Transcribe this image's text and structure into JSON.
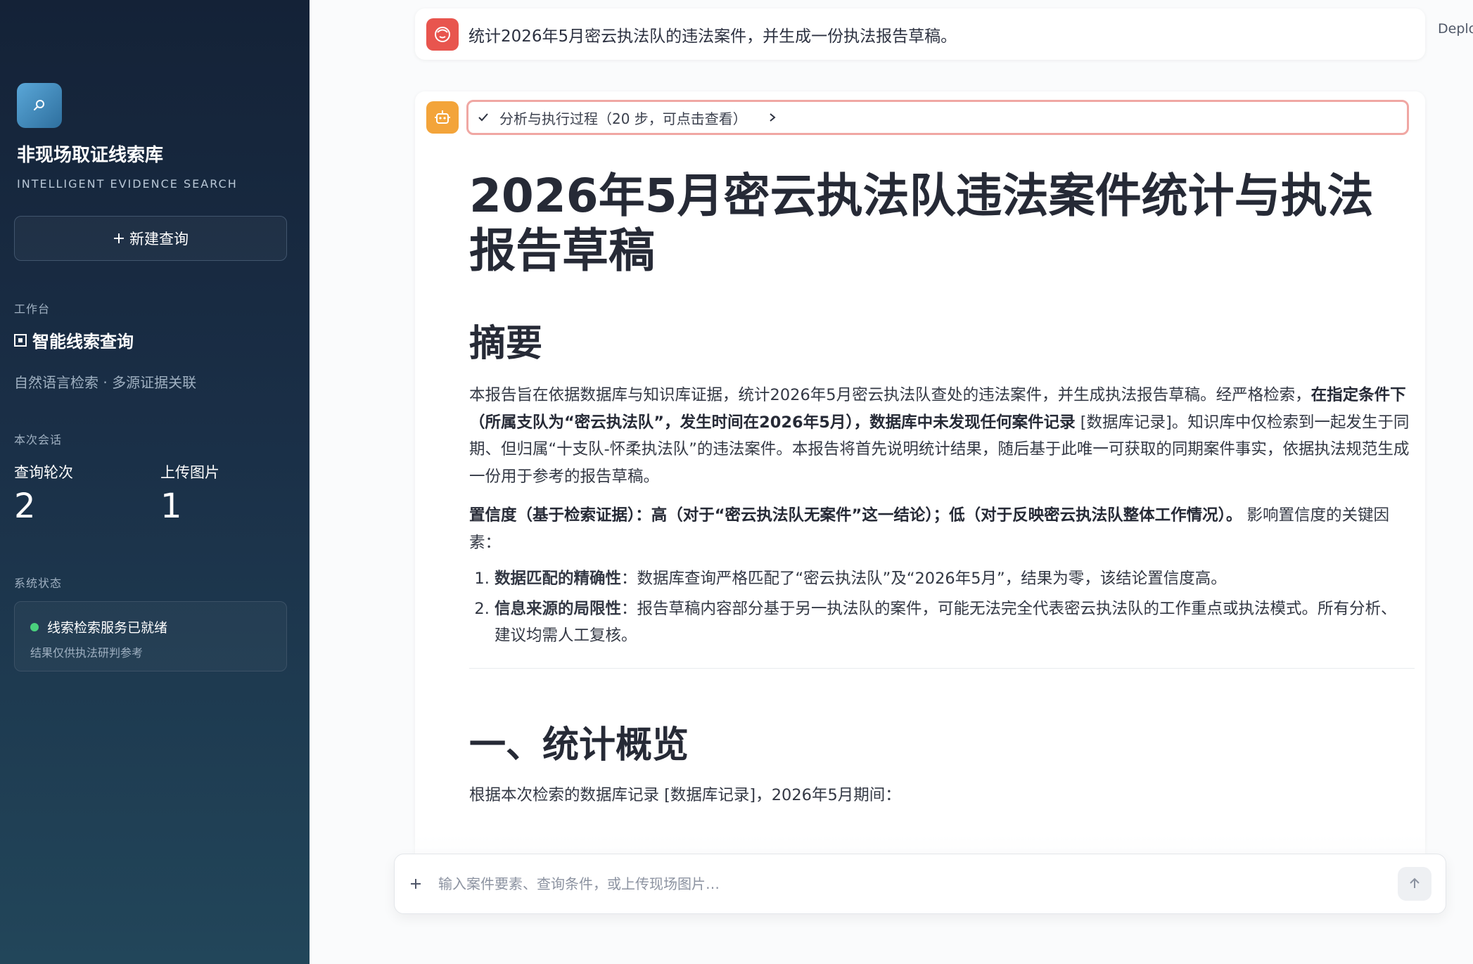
{
  "app": {
    "title": "非现场取证线索库",
    "subtitle": "INTELLIGENT EVIDENCE SEARCH",
    "new_query_label": "新建查询"
  },
  "sidebar": {
    "workbench_label": "工作台",
    "workbench_item": "智能线索查询",
    "workbench_desc": "自然语言检索 · 多源证据关联",
    "session_label": "本次会话",
    "stats": [
      {
        "label": "查询轮次",
        "value": "2"
      },
      {
        "label": "上传图片",
        "value": "1"
      }
    ],
    "system_label": "系统状态",
    "status_text": "线索检索服务已就绪",
    "status_note": "结果仅供执法研判参考",
    "status_color": "#4ad17d"
  },
  "header": {
    "deploy_label": "Deplo"
  },
  "chat": {
    "user_message": "统计2026年5月密云执法队的违法案件，并生成一份执法报告草稿。",
    "process_label": "分析与执行过程（20 步，可点击查看）",
    "report": {
      "title": "2026年5月密云执法队违法案件统计与执法报告草稿",
      "summary_heading": "摘要",
      "summary_p1": {
        "t1": "本报告旨在依据数据库与知识库证据，统计2026年5月密云执法队查处的违法案件，并生成执法报告草稿。经严格检索，",
        "b1": "在指定条件下（所属支队为“密云执法队”，发生时间在2026年5月），数据库中未发现任何案件记录",
        "t2": " [数据库记录]。知识库中仅检索到一起发生于同期、但归属“十支队-怀柔执法队”的违法案件。本报告将首先说明统计结果，随后基于此唯一可获取的同期案件事实，依据执法规范生成一份用于参考的报告草稿。"
      },
      "summary_p2": {
        "b1": "置信度（基于检索证据）：高（对于“密云执法队无案件”这一结论）；低（对于反映密云执法队整体工作情况）。",
        "t1": " 影响置信度的关键因素："
      },
      "factors": [
        {
          "bold": "数据匹配的精确性",
          "text": "：数据库查询严格匹配了“密云执法队”及“2026年5月”，结果为零，该结论置信度高。"
        },
        {
          "bold": "信息来源的局限性",
          "text": "：报告草稿内容部分基于另一执法队的案件，可能无法完全代表密云执法队的工作重点或执法模式。所有分析、建议均需人工复核。"
        }
      ],
      "section1_heading": "一、统计概览",
      "section1_intro": "根据本次检索的数据库记录 [数据库记录]，2026年5月期间："
    }
  },
  "input": {
    "placeholder": "输入案件要素、查询条件，或上传现场图片…"
  }
}
